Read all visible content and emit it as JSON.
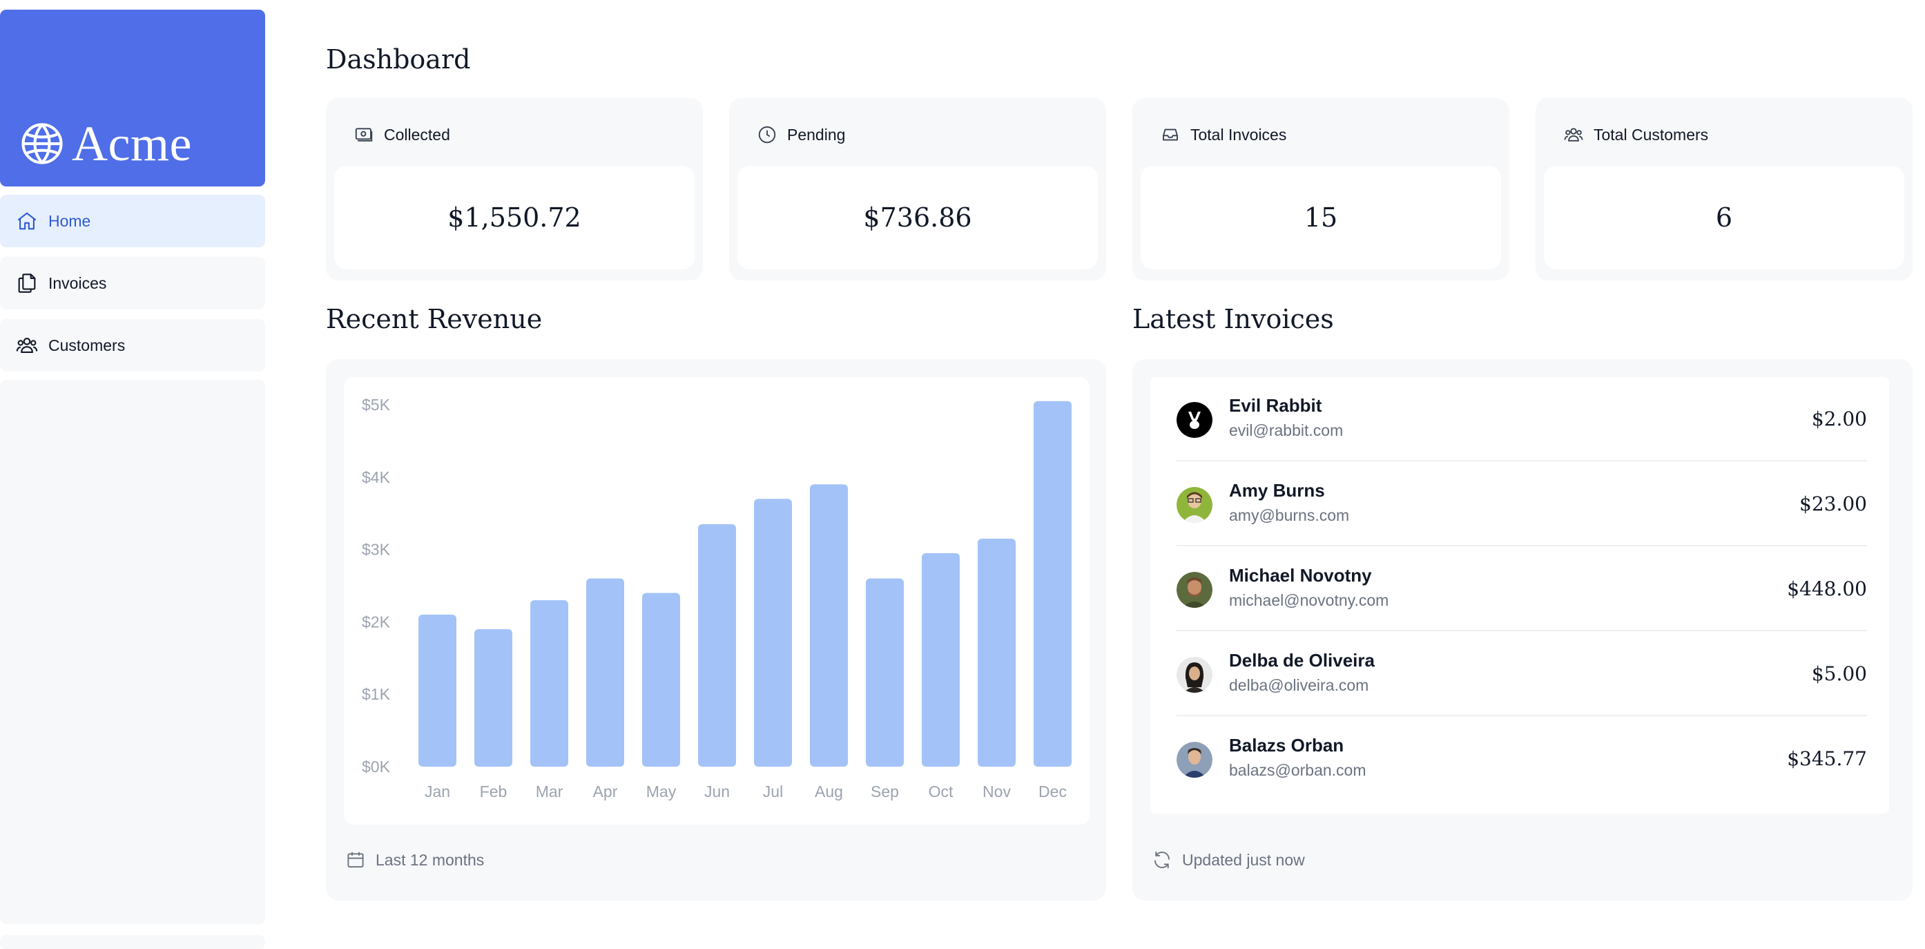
{
  "brand": {
    "name": "Acme"
  },
  "sidebar": {
    "items": [
      {
        "label": "Home",
        "icon": "home-icon",
        "active": true
      },
      {
        "label": "Invoices",
        "icon": "document-icon",
        "active": false
      },
      {
        "label": "Customers",
        "icon": "users-icon",
        "active": false
      }
    ]
  },
  "page": {
    "title": "Dashboard"
  },
  "cards": [
    {
      "label": "Collected",
      "value": "$1,550.72",
      "icon": "banknote-icon"
    },
    {
      "label": "Pending",
      "value": "$736.86",
      "icon": "clock-icon"
    },
    {
      "label": "Total Invoices",
      "value": "15",
      "icon": "inbox-icon"
    },
    {
      "label": "Total Customers",
      "value": "6",
      "icon": "users-icon"
    }
  ],
  "revenue": {
    "title": "Recent Revenue",
    "footer": "Last 12 months"
  },
  "chart_data": {
    "type": "bar",
    "categories": [
      "Jan",
      "Feb",
      "Mar",
      "Apr",
      "May",
      "Jun",
      "Jul",
      "Aug",
      "Sep",
      "Oct",
      "Nov",
      "Dec"
    ],
    "values": [
      2100,
      1900,
      2300,
      2600,
      2400,
      3350,
      3700,
      3900,
      2600,
      2950,
      3150,
      5050
    ],
    "y_ticks": [
      "$5K",
      "$4K",
      "$3K",
      "$2K",
      "$1K",
      "$0K"
    ],
    "ylim": [
      0,
      5000
    ],
    "bar_color": "#a3c3f8",
    "grid": false
  },
  "invoices": {
    "title": "Latest Invoices",
    "footer": "Updated just now",
    "rows": [
      {
        "name": "Evil Rabbit",
        "email": "evil@rabbit.com",
        "amount": "$2.00",
        "avatar": "evil-rabbit-avatar"
      },
      {
        "name": "Amy Burns",
        "email": "amy@burns.com",
        "amount": "$23.00",
        "avatar": "amy-burns-avatar"
      },
      {
        "name": "Michael Novotny",
        "email": "michael@novotny.com",
        "amount": "$448.00",
        "avatar": "michael-novotny-avatar"
      },
      {
        "name": "Delba de Oliveira",
        "email": "delba@oliveira.com",
        "amount": "$5.00",
        "avatar": "delba-de-oliveira-avatar"
      },
      {
        "name": "Balazs Orban",
        "email": "balazs@orban.com",
        "amount": "$345.77",
        "avatar": "balazs-orban-avatar"
      }
    ]
  },
  "colors": {
    "accent": "#4f6ee8",
    "active_nav_bg": "#e6effd",
    "active_nav_text": "#2f5bd3",
    "panel_bg": "#f7f8fa"
  }
}
